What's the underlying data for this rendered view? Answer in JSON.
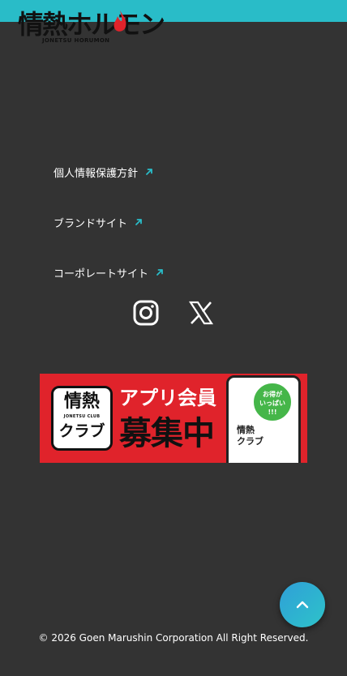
{
  "colors": {
    "background": "#333333",
    "top_bar": "#29bcc8",
    "link_arrow": "#29bcc8",
    "banner_red": "#e0232b",
    "scroll_button": "#2ec3c9"
  },
  "logo": {
    "main_text": "情熱ホルモン",
    "sub_text": "JONETSU HORUMON",
    "icon": "flame-icon"
  },
  "footer_links": [
    {
      "label": "個人情報保護方針",
      "icon": "external-arrow-icon"
    },
    {
      "label": "ブランドサイト",
      "icon": "external-arrow-icon"
    },
    {
      "label": "コーポレートサイト",
      "icon": "external-arrow-icon"
    }
  ],
  "social": {
    "instagram_icon": "instagram-icon",
    "x_icon": "x-icon"
  },
  "banner": {
    "logo_main": "情熱",
    "logo_club_en": "JONETSU CLUB",
    "logo_club": "クラブ",
    "headline": "アプリ会員",
    "headline_2": "募集中",
    "badge": "お得が\nいっぱい\n!!!",
    "phone_text": "情熱\nクラブ"
  },
  "scroll_top": {
    "icon": "chevron-up-icon"
  },
  "copyright": "© 2026 Goen Marushin Corporation All Right Reserved."
}
